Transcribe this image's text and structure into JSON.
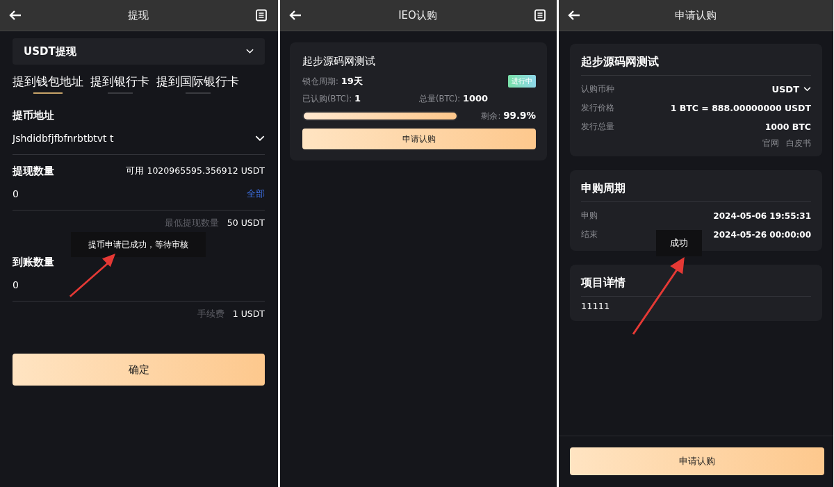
{
  "withdraw": {
    "title": "提现",
    "coin_select": "USDT提现",
    "tabs": [
      {
        "label": "提到钱包地址",
        "selected": true
      },
      {
        "label": "提到银行卡",
        "selected": false
      },
      {
        "label": "提到国际银行卡",
        "selected": false
      }
    ],
    "address_label": "提币地址",
    "address_value": "Jshdidbfjfbfnrbtbtvt t",
    "amount_label": "提现数量",
    "available": "可用 1020965595.356912 USDT",
    "amount_value": "0",
    "all_link": "全部",
    "min_label": "最低提现数量",
    "min_value": "50 USDT",
    "received_label": "到账数量",
    "received_value": "0",
    "fee_label": "手续费",
    "fee_value": "1 USDT",
    "confirm_button": "确定",
    "toast": "提币申请已成功，等待审核"
  },
  "ieo": {
    "title": "IEO认购",
    "card": {
      "name": "起步源码网测试",
      "lock_label": "锁仓周期:",
      "lock_value": "19天",
      "status": "进行中",
      "subscribed_label": "已认购(BTC):",
      "subscribed_value": "1",
      "total_label": "总量(BTC):",
      "total_value": "1000",
      "level": 0.999,
      "remaining_label": "剩余:",
      "remaining_value": "99.9%",
      "button": "申请认购"
    }
  },
  "apply": {
    "title": "申请认购",
    "project": "起步源码网测试",
    "rows": [
      {
        "label": "认购币种",
        "value": "USDT",
        "kind": "select"
      },
      {
        "label": "发行价格",
        "value": "1 BTC = 888.00000000 USDT",
        "kind": "text"
      },
      {
        "label": "发行总量",
        "value": "1000 BTC",
        "kind": "text"
      }
    ],
    "links": [
      "官网",
      "白皮书"
    ],
    "period_title": "申购周期",
    "period_rows": [
      {
        "label": "申购",
        "value": "2024-05-06 19:55:31"
      },
      {
        "label": "结束",
        "value": "2024-05-26 00:00:00"
      }
    ],
    "details_title": "项目详情",
    "details_text": "11111",
    "toast": "成功",
    "button": "申请认购"
  }
}
